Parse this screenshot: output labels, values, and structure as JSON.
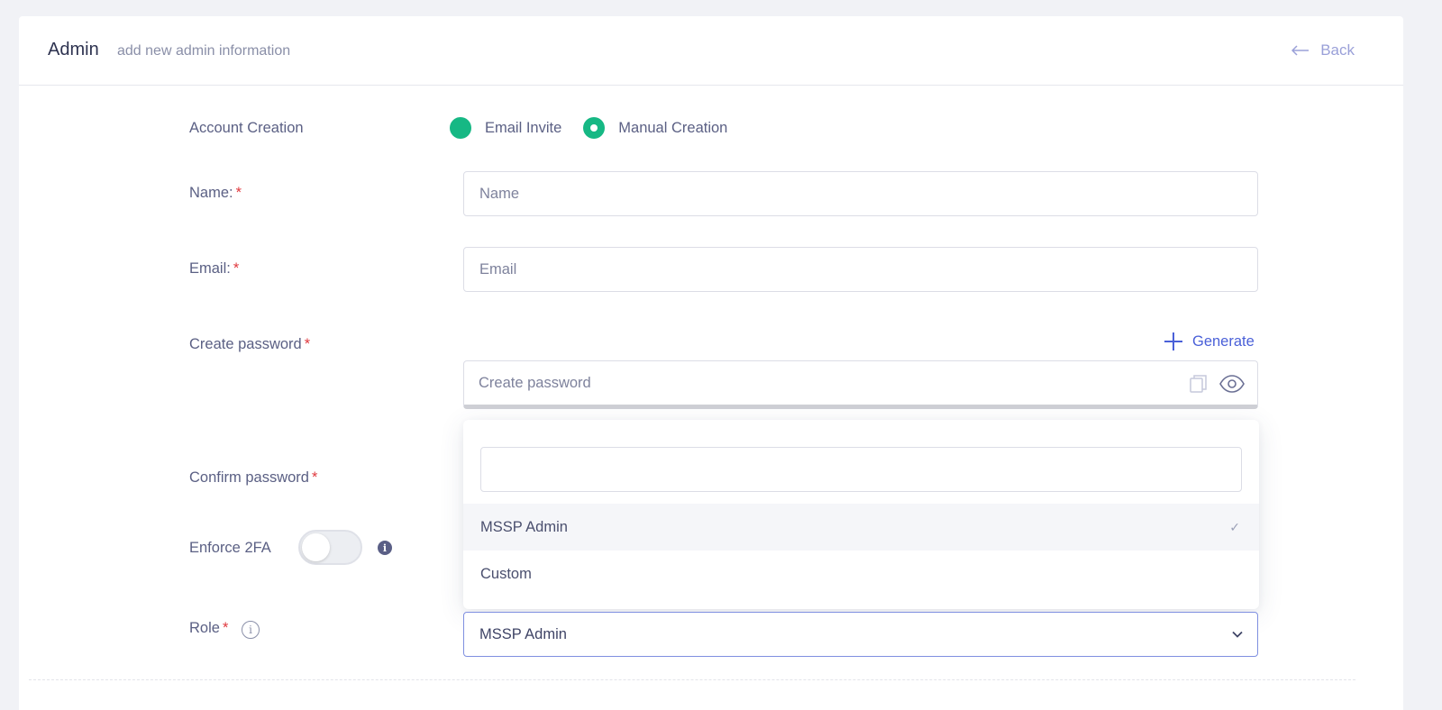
{
  "header": {
    "title": "Admin",
    "subtitle": "add new admin information",
    "back_label": "Back"
  },
  "form": {
    "account_creation": {
      "label": "Account Creation",
      "options": [
        {
          "label": "Email Invite",
          "selected": false
        },
        {
          "label": "Manual Creation",
          "selected": true
        }
      ]
    },
    "name": {
      "label": "Name:",
      "placeholder": "Name",
      "value": ""
    },
    "email": {
      "label": "Email:",
      "placeholder": "Email",
      "value": ""
    },
    "create_password": {
      "label": "Create password",
      "placeholder": "Create password",
      "generate_label": "Generate"
    },
    "confirm_password": {
      "label": "Confirm password"
    },
    "enforce_2fa": {
      "label": "Enforce 2FA",
      "enabled": false
    },
    "role": {
      "label": "Role",
      "selected": "MSSP Admin",
      "dropdown_search_value": "",
      "options": [
        {
          "label": "MSSP Admin",
          "selected": true
        },
        {
          "label": "Custom",
          "selected": false
        }
      ]
    },
    "required_marker": "*"
  },
  "colors": {
    "accent": "#4a60d8",
    "radio_green": "#16b884",
    "required_red": "#e0393e",
    "focus_border": "#7f8fe0"
  },
  "icons": {
    "back": "arrow-left-icon",
    "generate": "plus-icon",
    "copy": "copy-icon",
    "visibility": "eye-icon",
    "info": "info-icon",
    "chevron": "chevron-down-icon",
    "check": "check-icon"
  }
}
